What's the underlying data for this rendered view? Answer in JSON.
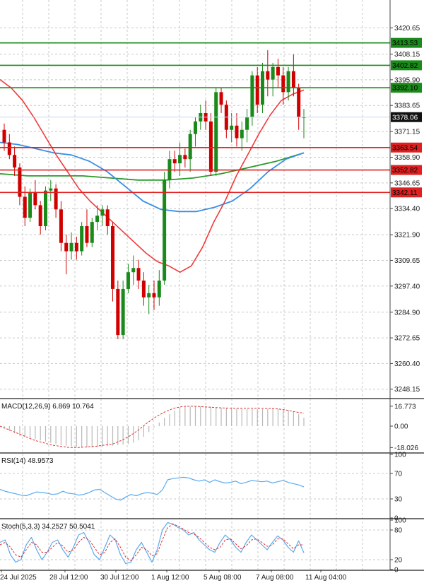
{
  "chart_data": {
    "type": "candlestick",
    "instrument_panel": {
      "y_ticks": [
        3420.65,
        3408.15,
        3395.9,
        3383.65,
        3371.15,
        3358.9,
        3346.65,
        3334.4,
        3321.9,
        3309.65,
        3297.4,
        3284.9,
        3272.65,
        3260.4,
        3248.15
      ],
      "y_tick_labels": [
        "3420.65",
        "3408.15",
        "3395.90",
        "3383.65",
        "3371.15",
        "3358.90",
        "3346.65",
        "3334.40",
        "3321.90",
        "3309.65",
        "3297.40",
        "3284.90",
        "3272.65",
        "3260.40",
        "3248.15"
      ],
      "ylim": [
        3244,
        3434
      ],
      "current_price": {
        "value": 3378.06,
        "label": "3378.06"
      },
      "resistance_levels": [
        {
          "value": 3413.53,
          "label": "3413.53",
          "color": "#1a8a1a"
        },
        {
          "value": 3402.82,
          "label": "3402.82",
          "color": "#1a8a1a"
        },
        {
          "value": 3392.1,
          "label": "3392.10",
          "color": "#1a8a1a"
        }
      ],
      "support_levels": [
        {
          "value": 3363.54,
          "label": "3363.54",
          "color": "#e02020"
        },
        {
          "value": 3352.82,
          "label": "3352.82",
          "color": "#e02020"
        },
        {
          "value": 3342.11,
          "label": "3342.11",
          "color": "#e02020"
        }
      ],
      "candles": [
        [
          3372,
          3375,
          3362,
          3366
        ],
        [
          3366,
          3370,
          3358,
          3360
        ],
        [
          3360,
          3364,
          3350,
          3354
        ],
        [
          3354,
          3356,
          3336,
          3340
        ],
        [
          3340,
          3345,
          3326,
          3330
        ],
        [
          3330,
          3344,
          3328,
          3342
        ],
        [
          3342,
          3348,
          3334,
          3336
        ],
        [
          3336,
          3338,
          3322,
          3326
        ],
        [
          3326,
          3345,
          3324,
          3343
        ],
        [
          3343,
          3348,
          3338,
          3344
        ],
        [
          3344,
          3346,
          3330,
          3334
        ],
        [
          3334,
          3338,
          3314,
          3318
        ],
        [
          3318,
          3322,
          3303,
          3314
        ],
        [
          3314,
          3323,
          3310,
          3318
        ],
        [
          3318,
          3321,
          3310,
          3314
        ],
        [
          3314,
          3328,
          3312,
          3326
        ],
        [
          3326,
          3334,
          3316,
          3318
        ],
        [
          3318,
          3330,
          3316,
          3328
        ],
        [
          3328,
          3336,
          3324,
          3331
        ],
        [
          3331,
          3336,
          3326,
          3334
        ],
        [
          3334,
          3336,
          3322,
          3326
        ],
        [
          3326,
          3328,
          3290,
          3296
        ],
        [
          3296,
          3300,
          3272,
          3274
        ],
        [
          3274,
          3300,
          3272,
          3296
        ],
        [
          3296,
          3308,
          3294,
          3304
        ],
        [
          3304,
          3312,
          3298,
          3306
        ],
        [
          3306,
          3310,
          3296,
          3300
        ],
        [
          3300,
          3304,
          3288,
          3292
        ],
        [
          3292,
          3298,
          3284,
          3294
        ],
        [
          3294,
          3300,
          3286,
          3292
        ],
        [
          3292,
          3305,
          3288,
          3300
        ],
        [
          3300,
          3352,
          3298,
          3348
        ],
        [
          3348,
          3362,
          3344,
          3358
        ],
        [
          3358,
          3362,
          3352,
          3356
        ],
        [
          3356,
          3366,
          3350,
          3360
        ],
        [
          3360,
          3363,
          3354,
          3358
        ],
        [
          3358,
          3372,
          3352,
          3370
        ],
        [
          3370,
          3378,
          3364,
          3376
        ],
        [
          3376,
          3384,
          3372,
          3380
        ],
        [
          3380,
          3386,
          3372,
          3376
        ],
        [
          3376,
          3380,
          3350,
          3352
        ],
        [
          3352,
          3392,
          3350,
          3390
        ],
        [
          3390,
          3392,
          3380,
          3384
        ],
        [
          3384,
          3386,
          3368,
          3372
        ],
        [
          3372,
          3380,
          3366,
          3374
        ],
        [
          3374,
          3380,
          3364,
          3368
        ],
        [
          3368,
          3376,
          3362,
          3372
        ],
        [
          3372,
          3382,
          3366,
          3378
        ],
        [
          3378,
          3400,
          3374,
          3398
        ],
        [
          3398,
          3402,
          3380,
          3384
        ],
        [
          3384,
          3404,
          3380,
          3400
        ],
        [
          3400,
          3410,
          3388,
          3396
        ],
        [
          3396,
          3404,
          3388,
          3402
        ],
        [
          3402,
          3406,
          3392,
          3398
        ],
        [
          3398,
          3402,
          3384,
          3390
        ],
        [
          3390,
          3402,
          3386,
          3400
        ],
        [
          3400,
          3408,
          3388,
          3392
        ],
        [
          3392,
          3394,
          3372,
          3378
        ],
        [
          3378,
          3382,
          3368,
          3378
        ]
      ],
      "ma20": [
        3396,
        3392,
        3386,
        3378,
        3369,
        3360,
        3352,
        3344,
        3338,
        3333,
        3328,
        3323,
        3318,
        3313,
        3309,
        3307,
        3304,
        3307,
        3316,
        3328,
        3338,
        3350,
        3360,
        3370,
        3379,
        3386,
        3389,
        3391
      ],
      "ma50": [
        3366,
        3365,
        3363,
        3361,
        3360,
        3357,
        3352,
        3345,
        3338,
        3334,
        3333,
        3333,
        3335,
        3338,
        3344,
        3352,
        3358,
        3361
      ],
      "ma100": [
        3351,
        3350,
        3350,
        3350,
        3349,
        3348,
        3348,
        3349,
        3351,
        3354,
        3357,
        3361
      ]
    },
    "macd_panel": {
      "label": "MACD(12,26,9) 6.869 10.764",
      "y_ticks": [
        16.773,
        0.0,
        -18.026
      ],
      "y_tick_labels": [
        "16.773",
        "0.00",
        "-18.026"
      ],
      "ylim": [
        -22,
        22
      ],
      "histogram": [
        -2,
        -4,
        -6,
        -8,
        -9,
        -10,
        -11,
        -12,
        -13,
        -14,
        -15,
        -16,
        -16.5,
        -17,
        -17.5,
        -18,
        -18,
        -18,
        -17.8,
        -17.5,
        -17,
        -16.5,
        -16,
        -15.5,
        -15,
        -14,
        -12,
        -9,
        -5,
        -1,
        3,
        7,
        10,
        13,
        15,
        16,
        16.5,
        16.8,
        16.8,
        16.6,
        16.4,
        16,
        15.5,
        15,
        14.8,
        14.6,
        14.5,
        14.4,
        14.3,
        14.2,
        14.3,
        14.5,
        14.6,
        14.5,
        14.2,
        13.5,
        12.5,
        10,
        7
      ],
      "signal": [
        0,
        -3,
        -6,
        -9,
        -12,
        -14,
        -16,
        -17,
        -18,
        -18,
        -17.5,
        -17,
        -16,
        -15,
        -12,
        -8,
        -3,
        3,
        8,
        12,
        15,
        16.5,
        16.8,
        16.5,
        16,
        15.5,
        15.2,
        15,
        15,
        15,
        15,
        14.8,
        14.5,
        13.5,
        12,
        10.8
      ]
    },
    "rsi_panel": {
      "label": "RSI(14) 48.9573",
      "y_ticks": [
        100,
        70,
        30,
        0
      ],
      "y_tick_labels": [
        "100",
        "70",
        "30",
        "0"
      ],
      "ylim": [
        0,
        100
      ],
      "values": [
        45,
        42,
        40,
        38,
        36,
        35,
        38,
        41,
        40,
        39,
        37,
        38,
        42,
        39,
        38,
        36,
        37,
        40,
        44,
        45,
        40,
        35,
        30,
        28,
        33,
        37,
        35,
        38,
        40,
        39,
        37,
        44,
        60,
        62,
        63,
        64,
        63,
        60,
        58,
        60,
        56,
        60,
        57,
        55,
        56,
        58,
        54,
        56,
        59,
        58,
        57,
        58,
        55,
        57,
        59,
        56,
        54,
        52,
        49
      ]
    },
    "stoch_panel": {
      "label": "Stoch(5,3,3) 34.2527 50.5041",
      "y_ticks": [
        100,
        80,
        20,
        0
      ],
      "y_tick_labels": [
        "100",
        "80",
        "20",
        "0"
      ],
      "ylim": [
        0,
        100
      ],
      "k": [
        55,
        60,
        30,
        15,
        20,
        50,
        65,
        40,
        20,
        35,
        55,
        60,
        40,
        25,
        45,
        70,
        75,
        55,
        30,
        20,
        45,
        70,
        60,
        30,
        12,
        15,
        40,
        55,
        35,
        15,
        40,
        80,
        95,
        92,
        85,
        80,
        70,
        75,
        60,
        50,
        40,
        35,
        55,
        70,
        60,
        45,
        35,
        55,
        70,
        60,
        50,
        40,
        55,
        68,
        60,
        45,
        35,
        58,
        34
      ],
      "d": [
        50,
        55,
        45,
        30,
        25,
        40,
        55,
        50,
        35,
        35,
        45,
        55,
        48,
        35,
        40,
        55,
        65,
        60,
        45,
        30,
        35,
        55,
        62,
        45,
        25,
        18,
        30,
        45,
        40,
        28,
        32,
        60,
        85,
        92,
        88,
        82,
        75,
        72,
        65,
        55,
        45,
        40,
        45,
        60,
        62,
        52,
        42,
        48,
        60,
        62,
        55,
        47,
        50,
        62,
        62,
        52,
        42,
        50,
        50
      ]
    },
    "x_tick_labels": [
      "24 Jul 2025",
      "28 Jul 12:00",
      "30 Jul 12:00",
      "1 Aug 12:00",
      "5 Aug 08:00",
      "7 Aug 08:00",
      "11 Aug 04:00"
    ],
    "colors": {
      "bull": "#1a8a1a",
      "bear": "#d00000",
      "ma20": "#f03a3a",
      "ma50": "#3a8ee6",
      "ma100": "#2a9a2a",
      "grid": "#c8c8c8",
      "macd_hist": "#b8b8b8",
      "macd_signal": "#e03030",
      "rsi": "#5aaaf0",
      "stoch_k": "#5aaaf0",
      "stoch_d": "#e03030"
    }
  }
}
